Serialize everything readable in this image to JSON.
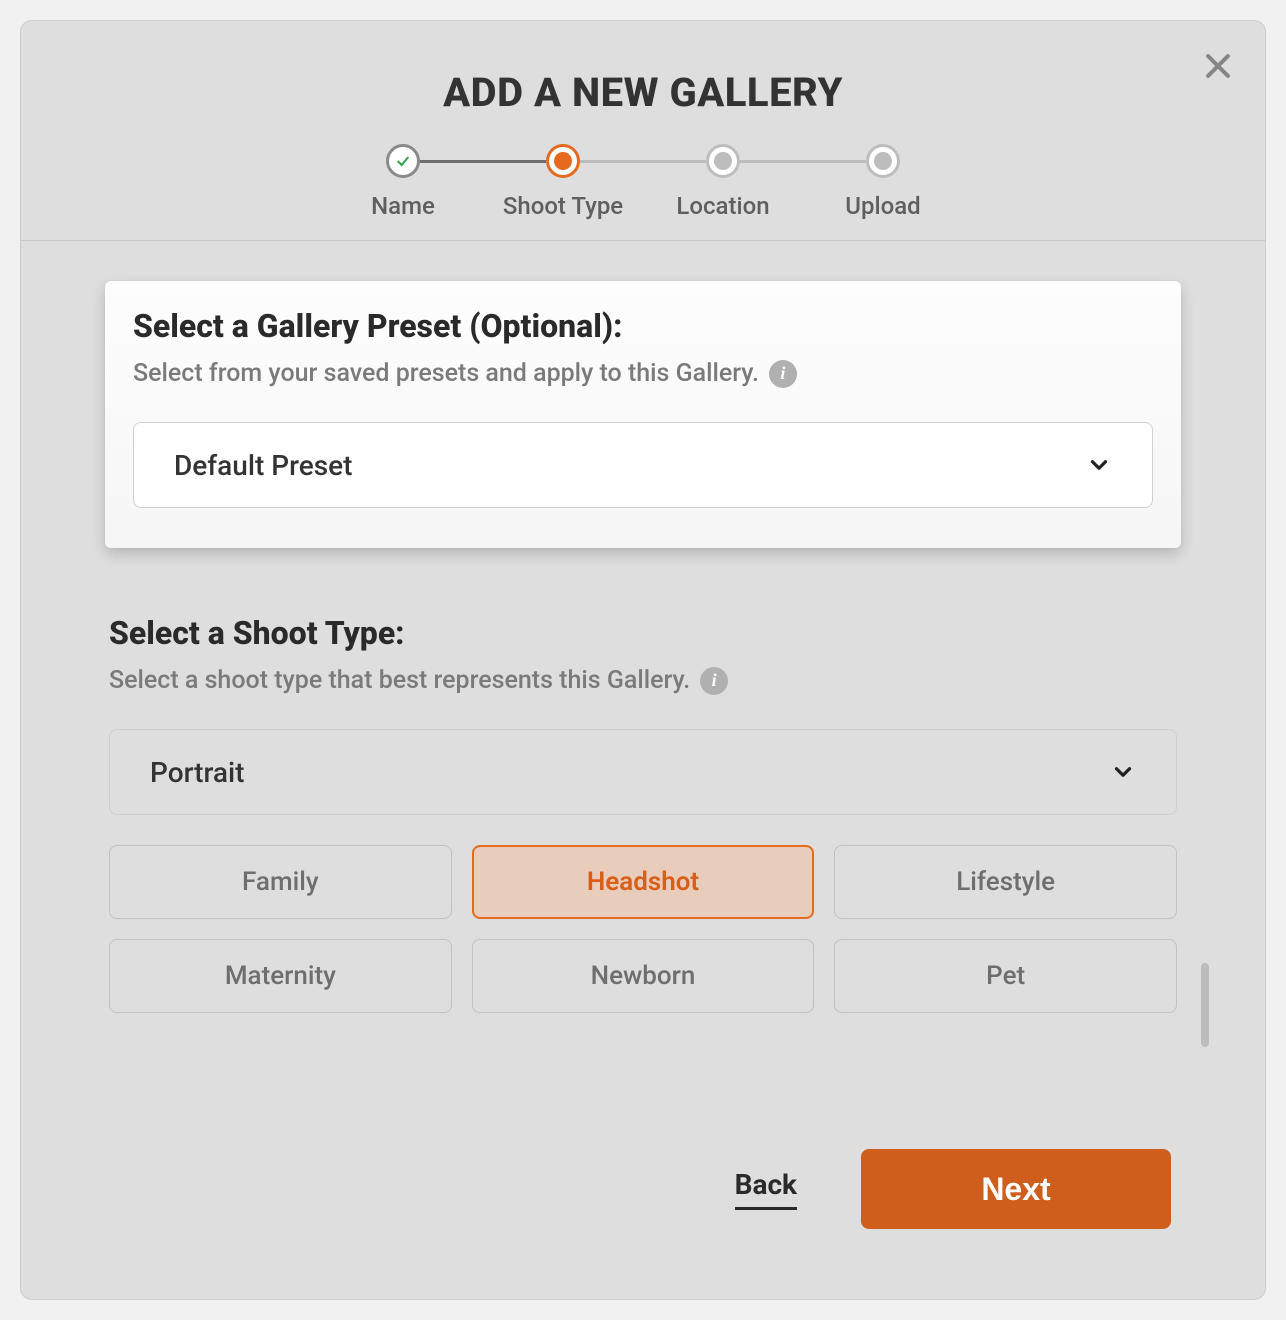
{
  "header": {
    "title": "ADD A NEW GALLERY"
  },
  "steps": [
    {
      "label": "Name",
      "state": "done"
    },
    {
      "label": "Shoot Type",
      "state": "active"
    },
    {
      "label": "Location",
      "state": "future"
    },
    {
      "label": "Upload",
      "state": "future"
    }
  ],
  "preset": {
    "title": "Select a Gallery Preset (Optional):",
    "sub": "Select from your saved presets and apply to this Gallery.",
    "selected": "Default Preset"
  },
  "shoot": {
    "title": "Select a Shoot Type:",
    "sub": "Select a shoot type that best represents this Gallery.",
    "selected_category": "Portrait",
    "options": [
      {
        "label": "Family",
        "selected": false
      },
      {
        "label": "Headshot",
        "selected": true
      },
      {
        "label": "Lifestyle",
        "selected": false
      },
      {
        "label": "Maternity",
        "selected": false
      },
      {
        "label": "Newborn",
        "selected": false
      },
      {
        "label": "Pet",
        "selected": false
      }
    ]
  },
  "footer": {
    "back": "Back",
    "next": "Next"
  },
  "colors": {
    "accent": "#e66a1e",
    "accent_dark": "#cf5e1c"
  }
}
